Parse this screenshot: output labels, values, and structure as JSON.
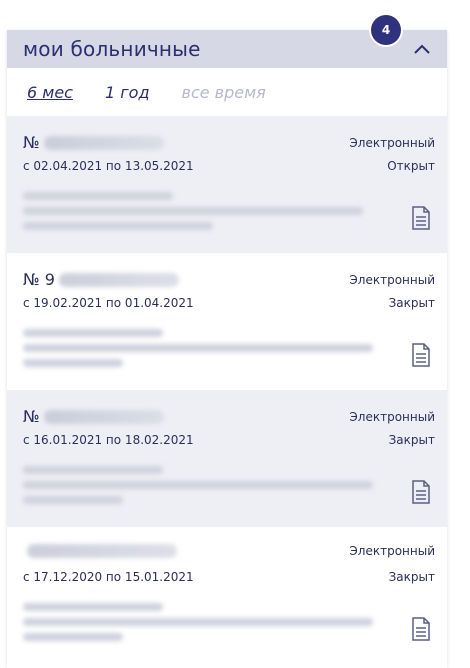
{
  "header": {
    "title": "мои больничные",
    "badge_count": "4"
  },
  "filters": [
    {
      "label": "6 мес",
      "state": "active"
    },
    {
      "label": "1 год",
      "state": "normal"
    },
    {
      "label": "все время",
      "state": "muted"
    }
  ],
  "items": [
    {
      "num_prefix": "№",
      "type": "Электронный",
      "dates": "с 02.04.2021 по 13.05.2021",
      "status": "Открыт"
    },
    {
      "num_prefix": "№ 9",
      "type": "Электронный",
      "dates": "с 19.02.2021 по 01.04.2021",
      "status": "Закрыт"
    },
    {
      "num_prefix": "№",
      "type": "Электронный",
      "dates": "с 16.01.2021 по 18.02.2021",
      "status": "Закрыт"
    },
    {
      "num_prefix": "",
      "type": "Электронный",
      "dates": "с 17.12.2020 по 15.01.2021",
      "status": "Закрыт"
    }
  ],
  "colors": {
    "header_bg": "#d6d8e6",
    "badge_bg": "#2f327d",
    "text": "#2b2f5a",
    "muted": "#b6b9cc",
    "item_gray": "#eeeff5"
  },
  "icons": {
    "collapse": "chevron-up-icon",
    "document": "document-icon"
  }
}
